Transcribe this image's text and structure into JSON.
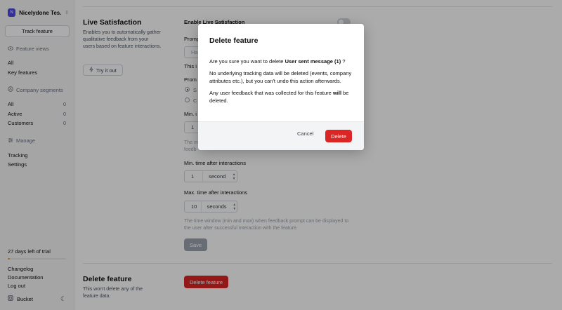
{
  "sidebar": {
    "org_initial": "N",
    "org_name": "Nicelydone Tes...",
    "track_button": "Track feature",
    "feature_views_label": "Feature views",
    "feature_views": [
      {
        "label": "All"
      },
      {
        "label": "Key features"
      }
    ],
    "company_segments_label": "Company segments",
    "segments": [
      {
        "label": "All",
        "count": "0"
      },
      {
        "label": "Active",
        "count": "0"
      },
      {
        "label": "Customers",
        "count": "0"
      }
    ],
    "manage_label": "Manage",
    "manage_items": [
      {
        "label": "Tracking"
      },
      {
        "label": "Settings"
      }
    ],
    "trial_text": "27 days left of trial",
    "trial_progress": 0.04,
    "footer_links": [
      "Changelog",
      "Documentation",
      "Log out"
    ],
    "brand": "Bucket"
  },
  "live_satisfaction": {
    "title": "Live Satisfaction",
    "description": "Enables you to automatically gather qualitative feedback from your users based on feature interactions.",
    "try_button": "Try it out",
    "enable_label": "Enable Live Satisfaction",
    "prompt_label_fragment": "Promp",
    "prompt_placeholder_fragment": "Ha",
    "this_fragment": "This i",
    "prompt_type_fragment": "Prom",
    "radio1_fragment": "S",
    "radio2_fragment": "C",
    "min_label_fragment": "Min. i",
    "min_value": "1",
    "help_fragment_1": "The m",
    "help_fragment_2": "feedb",
    "min_after_label": "Min. time after interactions",
    "min_after_value": "1",
    "min_after_unit": "second",
    "max_after_label": "Max. time after interactions",
    "max_after_value": "10",
    "max_after_unit": "seconds",
    "window_help": "The time window (min and max) when feedback prompt can be displayed to the user after successful interaction with the feature.",
    "save_button": "Save"
  },
  "delete_section": {
    "title": "Delete feature",
    "description": "This won't delete any of the feature data.",
    "button": "Delete feature"
  },
  "modal": {
    "title": "Delete feature",
    "question_prefix": "Are you sure you want to delete ",
    "feature_name": "User sent message (1)",
    "question_suffix": " ?",
    "para2": "No underlying tracking data will be deleted (events, company attributes etc.), but you can't undo this action afterwards.",
    "para3_prefix": "Any user feedback that was collected for this feature ",
    "para3_bold": "will",
    "para3_suffix": " be deleted.",
    "cancel": "Cancel",
    "confirm": "Delete"
  },
  "colors": {
    "danger": "#dc2626",
    "brand": "#4f46e5",
    "trial": "#f59e0b"
  }
}
